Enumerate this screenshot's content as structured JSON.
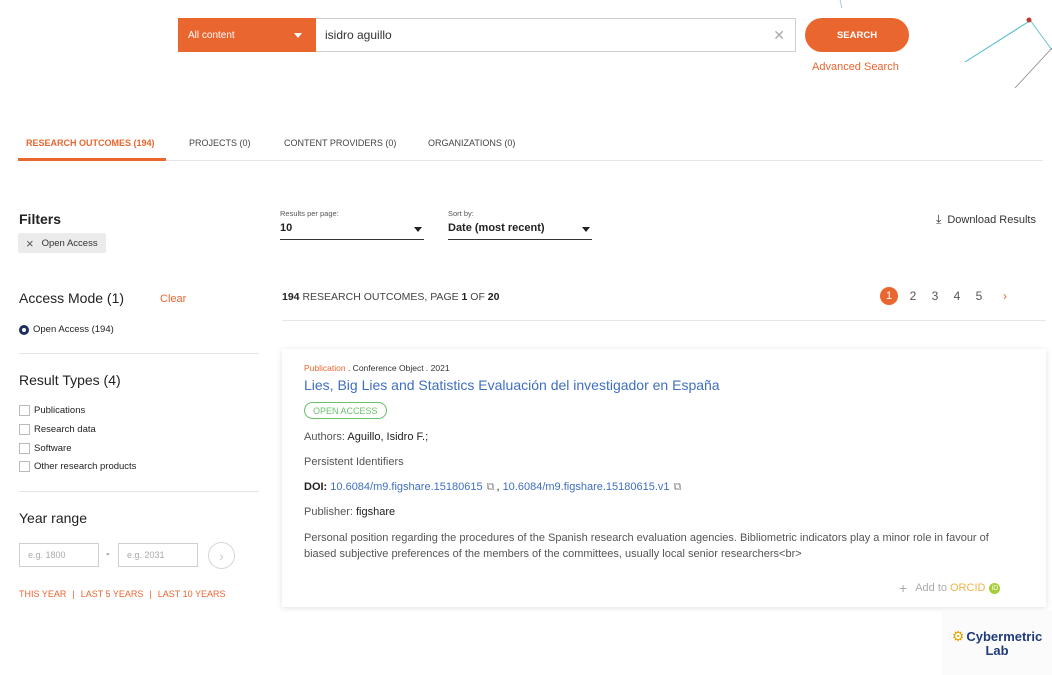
{
  "search": {
    "scope": "All content",
    "query": "isidro aguillo",
    "button": "SEARCH",
    "advanced": "Advanced Search"
  },
  "tabs": [
    {
      "label": "RESEARCH OUTCOMES (194)"
    },
    {
      "label": "PROJECTS (0)"
    },
    {
      "label": "CONTENT PROVIDERS (0)"
    },
    {
      "label": "ORGANIZATIONS (0)"
    }
  ],
  "filters": {
    "title": "Filters",
    "active_chip": "Open Access"
  },
  "access_mode": {
    "title": "Access Mode (1)",
    "clear": "Clear",
    "option": "Open Access (194)"
  },
  "result_types": {
    "title": "Result Types (4)",
    "options": [
      "Publications",
      "Research data",
      "Software",
      "Other research products"
    ]
  },
  "year_range": {
    "title": "Year range",
    "from_placeholder": "e.g. 1800",
    "dash": "-",
    "to_placeholder": "e.g. 2031",
    "quick": [
      "THIS YEAR",
      "LAST 5 YEARS",
      "LAST 10 YEARS"
    ],
    "sep": "|"
  },
  "controls": {
    "per_page_label": "Results per page:",
    "per_page_value": "10",
    "sort_label": "Sort by:",
    "sort_value": "Date (most recent)",
    "download": "Download Results"
  },
  "results": {
    "count": "194",
    "count_text": " RESEARCH OUTCOMES, PAGE ",
    "page": "1",
    "of_text": " OF ",
    "total_pages": "20"
  },
  "pager": {
    "current": "1",
    "pages": [
      "2",
      "3",
      "4",
      "5"
    ],
    "next": "›"
  },
  "card": {
    "type": "Publication",
    "meta": " . Conference Object . 2021",
    "title": "Lies, Big Lies and Statistics Evaluación del investigador en España",
    "badge": "OPEN ACCESS",
    "authors_label": "Authors: ",
    "authors": "Aguillo, Isidro F.;",
    "pid_label": "Persistent Identifiers",
    "doi_label": "DOI: ",
    "doi1": "10.6084/m9.figshare.15180615",
    "doi_sep": ",",
    "doi2": "10.6084/m9.figshare.15180615.v1",
    "publisher_label": "Publisher: ",
    "publisher": "figshare",
    "description": "Personal position regarding the procedures of the Spanish research evaluation agencies. Bibliometric indicators play a minor role in favour of biased subjective preferences of the members of the committees, usually local senior researchers<br>",
    "orcid_prefix": "Add to",
    "orcid": "ORCID",
    "orcid_badge": "iD"
  },
  "logo": {
    "line1": "Cybermetric",
    "line2": "Lab"
  },
  "colors": {
    "accent": "#e9662f",
    "link": "#3f6fc1",
    "open_access": "#6cc06c",
    "logo": "#1f3a7a"
  }
}
